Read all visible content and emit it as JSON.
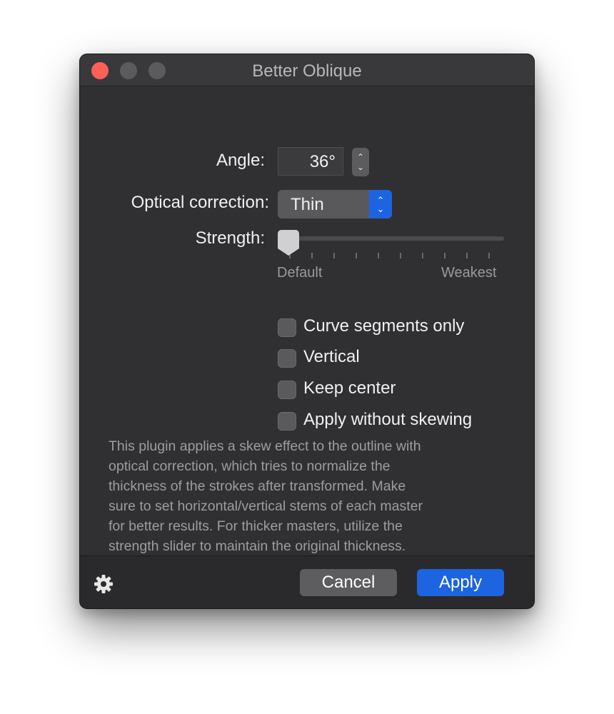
{
  "window": {
    "title": "Better Oblique"
  },
  "angle": {
    "label": "Angle:",
    "value": "36°"
  },
  "optical_correction": {
    "label": "Optical correction:",
    "selected": "Thin"
  },
  "strength": {
    "label": "Strength:",
    "min_label": "Default",
    "max_label": "Weakest",
    "value": 0
  },
  "options": [
    {
      "label": "Curve segments only",
      "checked": false
    },
    {
      "label": "Vertical",
      "checked": false
    },
    {
      "label": "Keep center",
      "checked": false
    },
    {
      "label": "Apply without skewing",
      "checked": false
    }
  ],
  "description": [
    "This plugin applies a skew effect to the outline with",
    "optical correction, which tries to normalize the",
    "thickness of the strokes after transformed. Make",
    "sure to set horizontal/vertical stems of each master",
    "for better results. For thicker masters, utilize the",
    "strength slider to maintain the original thickness."
  ],
  "footer": {
    "cancel_label": "Cancel",
    "apply_label": "Apply"
  },
  "colors": {
    "accent": "#1c64e0",
    "close": "#fe5f57",
    "window_bg": "#303033"
  },
  "icons": {
    "settings": "gear-icon",
    "stepper": "chevron-up-down-icon"
  }
}
